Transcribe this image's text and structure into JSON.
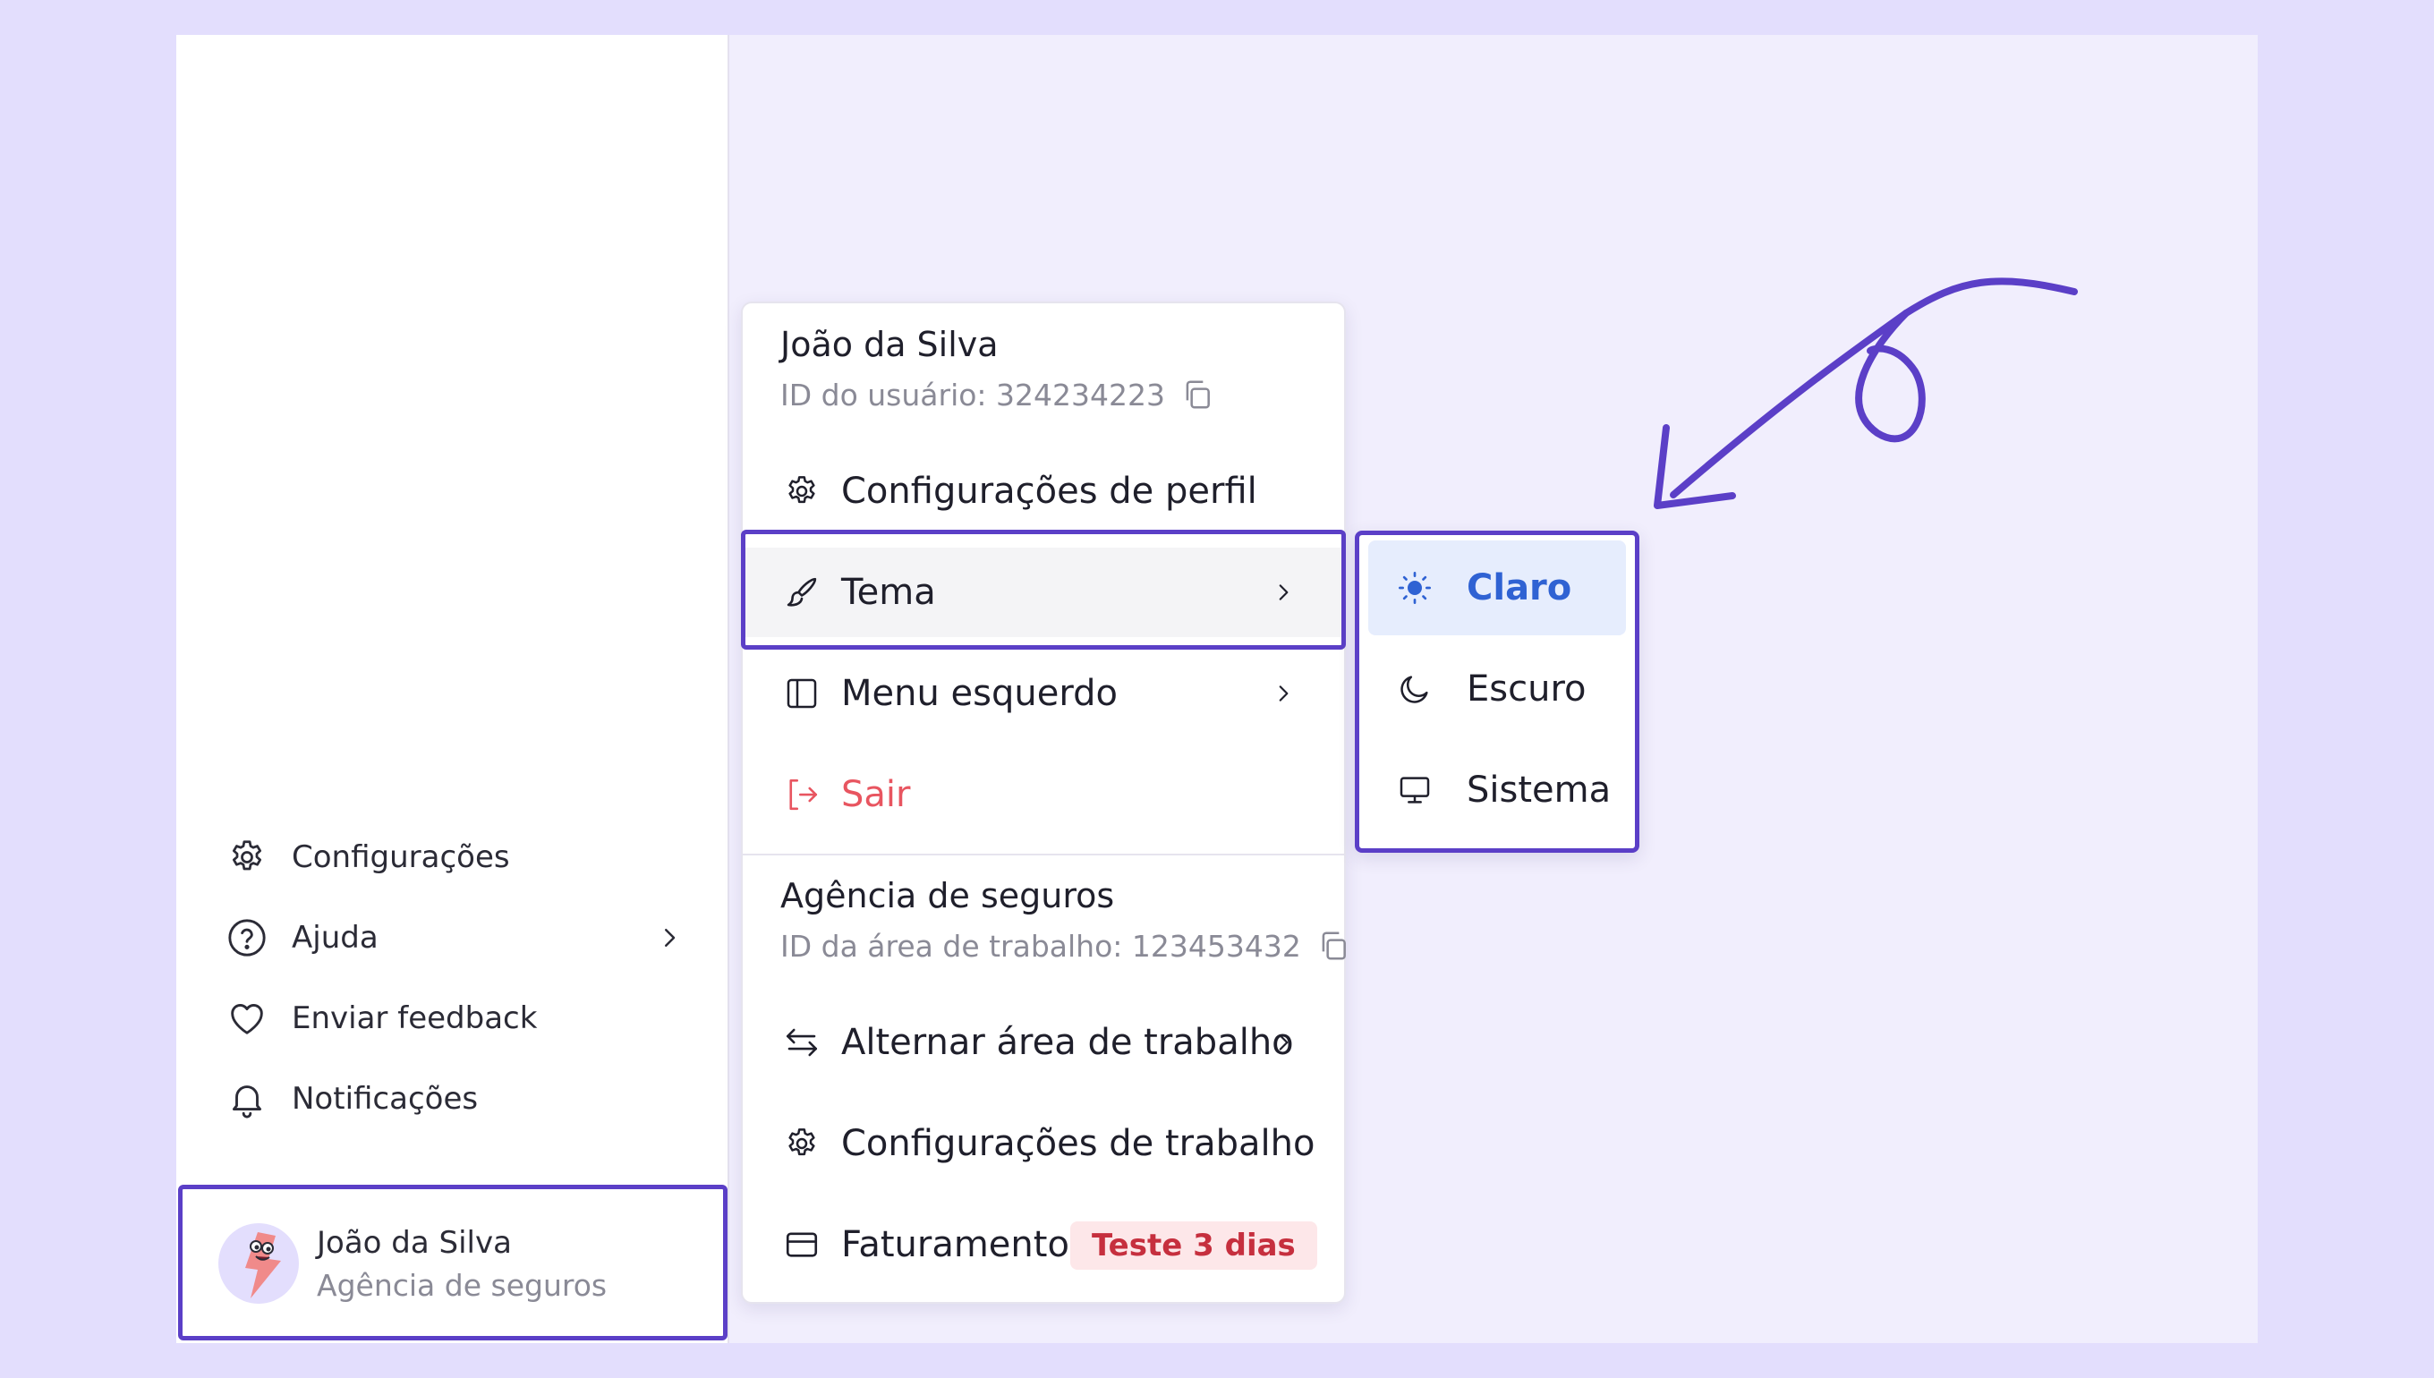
{
  "colors": {
    "background": "#e3defd",
    "canvas": "#f1eefd",
    "highlight": "#5b3fc7",
    "selected_bg": "#e6edfd",
    "selected_text": "#2f62d3",
    "danger": "#e85560",
    "badge_bg": "#fde7e9",
    "badge_text": "#c62f3e"
  },
  "sidebar": {
    "items": [
      {
        "label": "Configurações",
        "icon": "gear-icon"
      },
      {
        "label": "Ajuda",
        "icon": "help-circle-icon",
        "has_submenu": true
      },
      {
        "label": "Enviar feedback",
        "icon": "heart-icon"
      },
      {
        "label": "Notificações",
        "icon": "bell-icon"
      }
    ],
    "user": {
      "name": "João da Silva",
      "org": "Agência de seguros",
      "avatar_icon": "avatar-lightning-character"
    }
  },
  "menu": {
    "user_name": "João da Silva",
    "user_id": "ID do usuário: 324234223",
    "items": [
      {
        "label": "Configurações de perfil",
        "icon": "gear-icon"
      },
      {
        "label": "Tema",
        "icon": "paintbrush-icon",
        "has_submenu": true,
        "active": true
      },
      {
        "label": "Menu esquerdo",
        "icon": "sidebar-panel-icon",
        "has_submenu": true
      },
      {
        "label": "Sair",
        "icon": "logout-icon",
        "danger": true
      }
    ],
    "workspace_name": "Agência de seguros",
    "workspace_id": "ID da área de trabalho: 123453432",
    "workspace_items": [
      {
        "label": "Alternar área de trabalho",
        "icon": "switch-arrows-icon",
        "has_submenu": true
      },
      {
        "label": "Configurações de trabalho",
        "icon": "gear-icon"
      },
      {
        "label": "Faturamento",
        "icon": "credit-card-icon",
        "badge": "Teste 3 dias"
      }
    ]
  },
  "theme_submenu": {
    "options": [
      {
        "label": "Claro",
        "icon": "sun-icon",
        "selected": true
      },
      {
        "label": "Escuro",
        "icon": "moon-icon"
      },
      {
        "label": "Sistema",
        "icon": "monitor-icon"
      }
    ]
  }
}
